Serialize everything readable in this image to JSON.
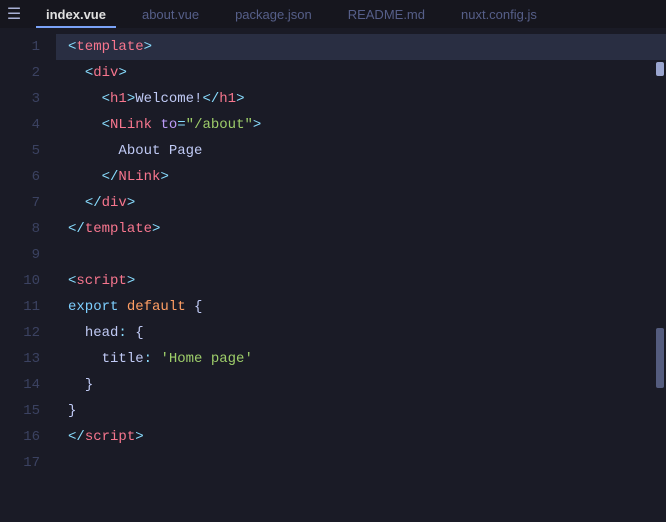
{
  "tabs": [
    {
      "label": "index.vue",
      "active": true
    },
    {
      "label": "about.vue",
      "active": false
    },
    {
      "label": "package.json",
      "active": false
    },
    {
      "label": "README.md",
      "active": false
    },
    {
      "label": "nuxt.config.js",
      "active": false
    }
  ],
  "lineNumbers": [
    "1",
    "2",
    "3",
    "4",
    "5",
    "6",
    "7",
    "8",
    "9",
    "10",
    "11",
    "12",
    "13",
    "14",
    "15",
    "16",
    "17"
  ],
  "code": {
    "l1": {
      "open": "<",
      "tag": "template",
      "close": ">"
    },
    "l2": {
      "open": "<",
      "tag": "div",
      "close": ">"
    },
    "l3": {
      "open": "<",
      "tag": "h1",
      "close": ">",
      "text": "Welcome!",
      "copen": "</",
      "ctag": "h1",
      "cclose": ">"
    },
    "l4": {
      "open": "<",
      "tag": "NLink",
      "attr": "to",
      "eq": "=",
      "q1": "\"",
      "val": "/about",
      "q2": "\"",
      "close": ">"
    },
    "l5": {
      "text": "About Page"
    },
    "l6": {
      "open": "</",
      "tag": "NLink",
      "close": ">"
    },
    "l7": {
      "open": "</",
      "tag": "div",
      "close": ">"
    },
    "l8": {
      "open": "</",
      "tag": "template",
      "close": ">"
    },
    "l10": {
      "open": "<",
      "tag": "script",
      "close": ">"
    },
    "l11": {
      "kw1": "export",
      "kw2": "default",
      "brace": "{"
    },
    "l12": {
      "prop": "head",
      "colon": ":",
      "brace": "{"
    },
    "l13": {
      "prop": "title",
      "colon": ":",
      "q1": "'",
      "val": "Home page",
      "q2": "'"
    },
    "l14": {
      "brace": "}"
    },
    "l15": {
      "brace": "}"
    },
    "l16": {
      "open": "</",
      "tag": "script",
      "close": ">"
    }
  }
}
